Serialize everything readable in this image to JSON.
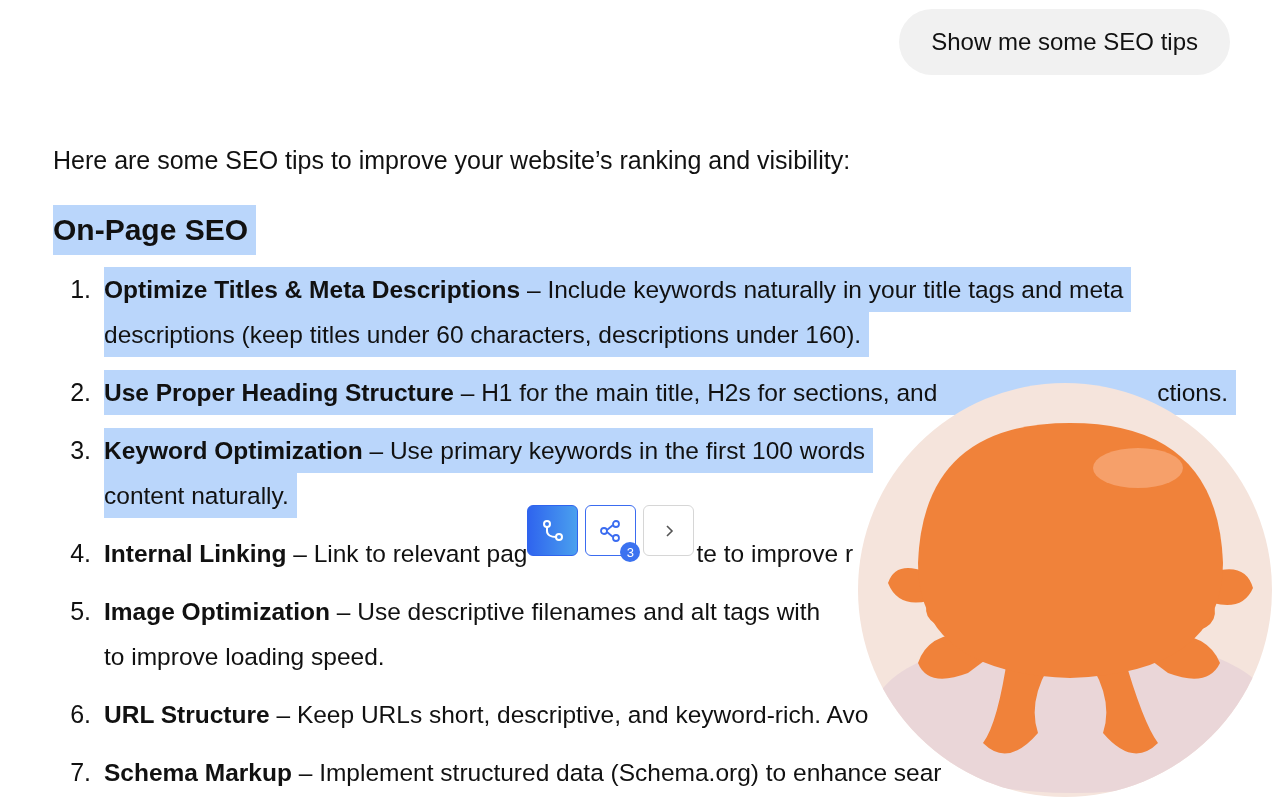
{
  "user_message": {
    "text": "Show me some SEO tips"
  },
  "intro": "Here are some SEO tips to improve your website’s ranking and visibility:",
  "heading": {
    "text": "On-Page SEO",
    "highlighted": true
  },
  "items": [
    {
      "number": "1.",
      "highlighted": true,
      "lines": [
        [
          "**Optimize Titles & Meta Descriptions** – Include keywords naturally in your title tags and meta"
        ],
        [
          "descriptions (keep titles under 60 characters, descriptions under 160)."
        ]
      ]
    },
    {
      "number": "2.",
      "highlighted": true,
      "lines": [
        [
          "**Use Proper Heading Structure** – H1 for the main title, H2s for sections, and",
          "ctions."
        ]
      ]
    },
    {
      "number": "3.",
      "highlighted": true,
      "lines": [
        [
          "**Keyword Optimization** – Use primary keywords in the first 100 words"
        ],
        [
          "content naturally."
        ]
      ]
    },
    {
      "number": "4.",
      "highlighted": false,
      "lines": [
        [
          "**Internal Linking** – Link to relevant pag",
          "te to improve r"
        ]
      ],
      "toolbar": {
        "buttons": [
          {
            "kind": "branch",
            "selected": true
          },
          {
            "kind": "share",
            "selected": false,
            "badge": "3"
          },
          {
            "kind": "next",
            "selected": false
          }
        ]
      }
    },
    {
      "number": "5.",
      "highlighted": false,
      "lines": [
        [
          "**Image Optimization** – Use descriptive filenames and alt tags with"
        ],
        [
          "to improve loading speed."
        ]
      ]
    },
    {
      "number": "6.",
      "highlighted": false,
      "lines": [
        [
          "**URL Structure** – Keep URLs short, descriptive, and keyword-rich. Avo"
        ]
      ]
    },
    {
      "number": "7.",
      "highlighted": false,
      "lines": [
        [
          "**Schema Markup** – Implement structured data (Schema.org) to enhance sear"
        ]
      ]
    }
  ]
}
